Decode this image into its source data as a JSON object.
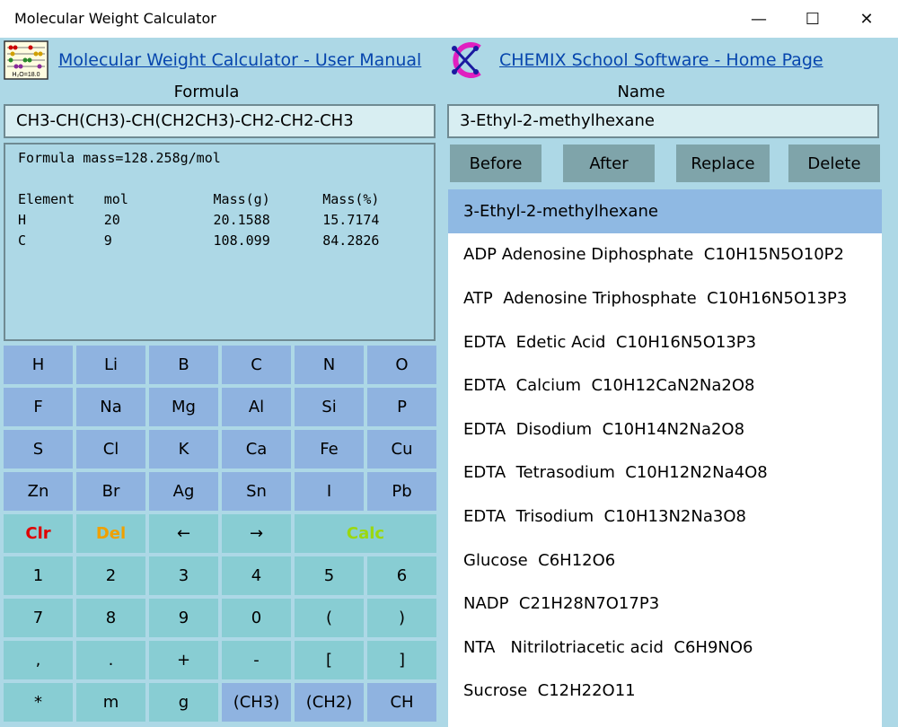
{
  "window": {
    "title": "Molecular Weight Calculator",
    "minimize": "—",
    "maximize": "☐",
    "close": "✕"
  },
  "links": {
    "manual": "Molecular Weight Calculator - User Manual",
    "home": "CHEMIX School Software - Home Page"
  },
  "logo_left": {
    "text": "H₂O=18.0"
  },
  "labels": {
    "formula": "Formula",
    "name": "Name"
  },
  "formula_value": "CH3-CH(CH3)-CH(CH2CH3)-CH2-CH2-CH3",
  "name_value": "3-Ethyl-2-methylhexane",
  "results": {
    "mass_line": "Formula mass=128.258g/mol",
    "headers": [
      "Element",
      "mol",
      "Mass(g)",
      "Mass(%)"
    ],
    "rows": [
      [
        "H",
        "20",
        "20.1588",
        "15.7174"
      ],
      [
        "C",
        "9",
        "108.099",
        "84.2826"
      ]
    ]
  },
  "keypad": {
    "elements": [
      "H",
      "Li",
      "B",
      "C",
      "N",
      "O",
      "F",
      "Na",
      "Mg",
      "Al",
      "Si",
      "P",
      "S",
      "Cl",
      "K",
      "Ca",
      "Fe",
      "Cu",
      "Zn",
      "Br",
      "Ag",
      "Sn",
      "I",
      "Pb"
    ],
    "controls": {
      "clr": "Clr",
      "del": "Del",
      "left": "←",
      "right": "→",
      "calc": "Calc"
    },
    "digits": [
      "1",
      "2",
      "3",
      "4",
      "5",
      "6",
      "7",
      "8",
      "9",
      "0",
      "(",
      ")"
    ],
    "symbols": [
      ",",
      ".",
      "+",
      "-",
      "[",
      "]",
      "*",
      "m",
      "g",
      "(CH3)",
      "(CH2)",
      "CH"
    ]
  },
  "buttons": {
    "before": "Before",
    "after": "After",
    "replace": "Replace",
    "delete": "Delete"
  },
  "list": {
    "selected_index": 0,
    "items": [
      "3-Ethyl-2-methylhexane",
      "ADP Adenosine Diphosphate  C10H15N5O10P2",
      "ATP  Adenosine Triphosphate  C10H16N5O13P3",
      "EDTA  Edetic Acid  C10H16N5O13P3",
      "EDTA  Calcium  C10H12CaN2Na2O8",
      "EDTA  Disodium  C10H14N2Na2O8",
      "EDTA  Tetrasodium  C10H12N2Na4O8",
      "EDTA  Trisodium  C10H13N2Na3O8",
      "Glucose  C6H12O6",
      "NADP  C21H28N7O17P3",
      "NTA   Nitrilotriacetic acid  C6H9NO6",
      "Sucrose  C12H22O11"
    ]
  },
  "colors": {
    "background": "#add8e6",
    "key_blue": "#8fb3e0",
    "key_teal": "#88cdd3",
    "clr": "#e00000",
    "del": "#f0a000",
    "calc": "#9bd80e",
    "button": "#7fa4aa",
    "selected": "#8fb9e3",
    "link": "#0645ad"
  }
}
